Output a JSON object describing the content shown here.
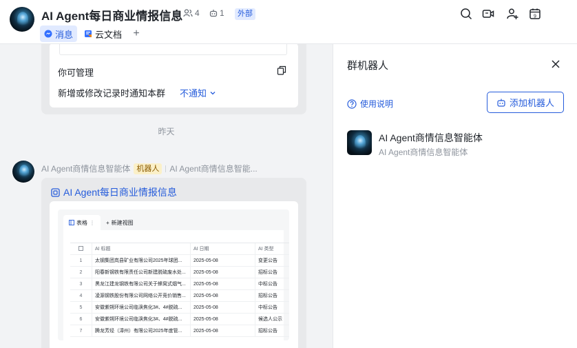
{
  "header": {
    "title": "AI Agent每日商业情报信息",
    "member_count": "4",
    "bot_count": "1",
    "external_tag": "外部",
    "tabs": [
      {
        "label": "消息",
        "icon": "chat-icon",
        "active": true
      },
      {
        "label": "云文档",
        "icon": "doc-icon",
        "active": false
      }
    ],
    "add_tab": "+",
    "actions": [
      "search-icon",
      "video-call-icon",
      "add-member-icon",
      "calendar-icon"
    ],
    "calendar_day": "9"
  },
  "chat": {
    "card1": {
      "permission_text": "你可管理",
      "notify_text": "新增或修改记录时通知本群",
      "notify_value": "不通知"
    },
    "date_separator": "昨天",
    "message": {
      "sender": "AI Agent商情信息智能体",
      "sender_tag": "机器人",
      "sender_desc": "AI Agent商情信息智能...",
      "doc_title": "AI Agent每日商业情报信息",
      "mini_table": {
        "tab_label": "表格",
        "add_view": "新建视图",
        "columns": [
          "AI 标题",
          "AI 日期",
          "AI 类型"
        ],
        "rows": [
          {
            "idx": "1",
            "title": "太钢集团岚县矿业有限公司2025年球团...",
            "date": "2025-05-08",
            "type": "变更公告"
          },
          {
            "idx": "2",
            "title": "阳春新钢铁有限责任公司新建脱硫废水处...",
            "date": "2025-05-08",
            "type": "招标公告"
          },
          {
            "idx": "3",
            "title": "黑龙江建龙钢铁有限公司关于蜂窝式烟气...",
            "date": "2025-05-08",
            "type": "中标公告"
          },
          {
            "idx": "4",
            "title": "凌源钢铁股份有限公司网络公开竞价销售...",
            "date": "2025-05-08",
            "type": "招标公告"
          },
          {
            "idx": "5",
            "title": "安徽紫朔环境公司临涣焦化3#、4#脱硫...",
            "date": "2025-05-08",
            "type": "中标公告"
          },
          {
            "idx": "6",
            "title": "安徽紫朔环境公司临涣焦化3#、4#脱硫...",
            "date": "2025-05-08",
            "type": "候选人公示"
          },
          {
            "idx": "7",
            "title": "腾龙芳烃（漳州）有限公司2025年度管...",
            "date": "2025-05-08",
            "type": "招标公告"
          }
        ]
      }
    }
  },
  "panel": {
    "title": "群机器人",
    "help_link": "使用说明",
    "add_button": "添加机器人",
    "bot": {
      "name": "AI Agent商情信息智能体",
      "desc": "AI Agent商情信息智能体"
    }
  },
  "colors": {
    "accent": "#245bdb",
    "chat_bg": "#f2f3f5",
    "bot_tag_bg": "#fbf0c8"
  }
}
